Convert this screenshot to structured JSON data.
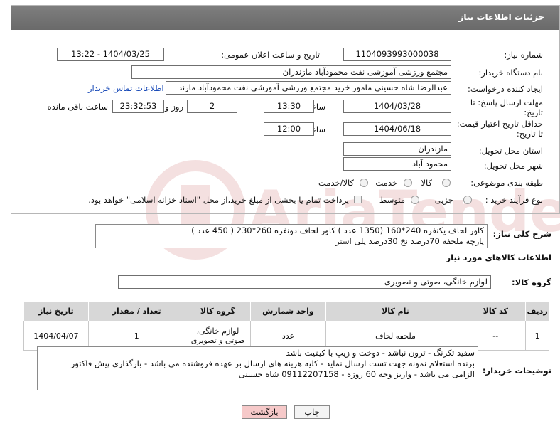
{
  "header": {
    "title": "جزئیات اطلاعات نیاز"
  },
  "fields": {
    "need_number_label": "شماره نیاز:",
    "need_number": "1104093993000038",
    "announce_label": "تاریخ و ساعت اعلان عمومی:",
    "announce_value": "1404/03/25 - 13:22",
    "buyer_org_label": "نام دستگاه خریدار:",
    "buyer_org": "مجتمع ورزشی آموزشی نفت محمودآباد مازندران",
    "creator_label": "ایجاد کننده درخواست:",
    "creator": "عبدالرضا شاه حسینی مامور خرید مجتمع ورزشی آموزشی نفت محمودآباد مازند",
    "contact_link": "اطلاعات تماس خریدار",
    "deadline_label_1": "مهلت ارسال پاسخ: تا",
    "deadline_label_2": "تاریخ:",
    "deadline_date": "1404/03/28",
    "time_label": "ساعت",
    "deadline_time": "13:30",
    "days_count": "2",
    "days_label": "روز و",
    "remaining_time": "23:32:53",
    "remaining_label": "ساعت باقی مانده",
    "validity_label_1": "حداقل تاریخ اعتبار قیمت:",
    "validity_label_2": "تا تاریخ:",
    "validity_date": "1404/06/18",
    "validity_time": "12:00",
    "province_label": "استان محل تحویل:",
    "province": "مازندران",
    "city_label": "شهر محل تحویل:",
    "city": "محمود آباد",
    "category_label": "طبقه بندی موضوعی:",
    "category_options": [
      "کالا",
      "خدمت",
      "کالا/خدمت"
    ],
    "process_label": "نوع فرآیند خرید :",
    "process_options": [
      "جزیی",
      "متوسط"
    ],
    "payment_note": "پرداخت تمام یا بخشی از مبلغ خرید،از محل \"اسناد خزانه اسلامی\" خواهد بود."
  },
  "summary": {
    "label": "شرح کلی نیاز:",
    "line1": "کاور لحاف یکنفره 240*160 (1350 عدد )      کاور لحاف دونفره 260*230 ( 450 عدد )",
    "line2": "پارچه ملحفه 70درصد نخ 30درصد پلی استر"
  },
  "goods_info_title": "اطلاعات کالاهای مورد نیاز",
  "goods_group": {
    "label": "گروه کالا:",
    "value": "لوازم خانگی، صوتی و تصویری"
  },
  "table": {
    "headers": [
      "ردیف",
      "کد کالا",
      "نام کالا",
      "واحد شمارش",
      "گروه کالا",
      "تعداد / مقدار",
      "تاریخ نیاز"
    ],
    "rows": [
      [
        "1",
        "--",
        "ملحفه لحاف",
        "عدد",
        "لوازم خانگی، صوتی و تصویری",
        "1",
        "1404/04/07"
      ]
    ]
  },
  "buyer_notes": {
    "label": "توضیحات خریدار:",
    "line1": "سفید تکرنگ - ترون نباشد - دوخت و زیپ با کیفیت باشد",
    "line2": "برنده استعلام نمونه جهت تست ارسال نماید - کلیه هزینه های ارسال بر عهده فروشنده می باشد - بارگذاری پیش فاکتور",
    "line3": "الزامی می باشد - واریز وجه 60 روزه - 09112207158 شاه حسینی"
  },
  "buttons": {
    "print": "چاپ",
    "back": "بازگشت"
  },
  "colors": {
    "header_bg": "#737373",
    "back_button_bg": "#f6c9c9",
    "link": "#1a4bb8"
  }
}
